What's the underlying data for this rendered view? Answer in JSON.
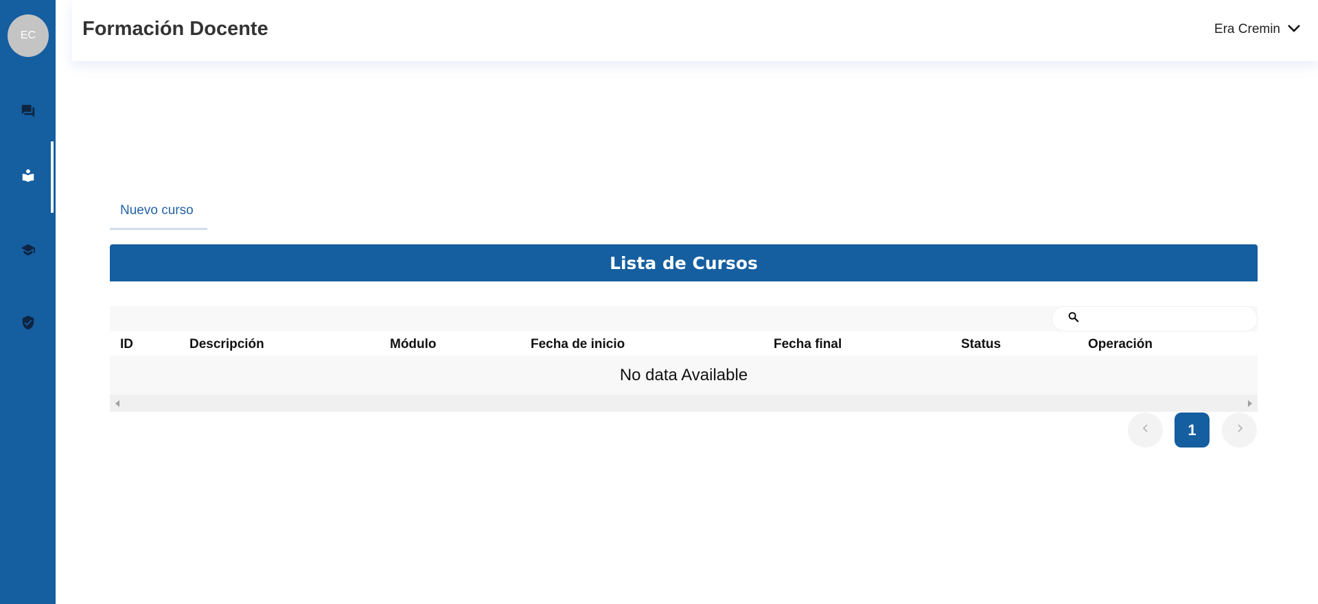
{
  "sidebar": {
    "avatar_initials": "EC",
    "items": [
      {
        "name": "forum",
        "icon": "forum-icon",
        "active": false
      },
      {
        "name": "teaching",
        "icon": "book-reader-icon",
        "active": true
      },
      {
        "name": "education",
        "icon": "graduation-cap-icon",
        "active": false
      },
      {
        "name": "security",
        "icon": "shield-check-icon",
        "active": false
      }
    ]
  },
  "header": {
    "title": "Formación Docente",
    "user_name": "Era Cremin"
  },
  "tabs": [
    {
      "label": "Nuevo curso"
    }
  ],
  "table": {
    "title": "Lista de Cursos",
    "search_placeholder": "",
    "columns": [
      "ID",
      "Descripción",
      "Módulo",
      "Fecha de inicio",
      "Fecha final",
      "Status",
      "Operación"
    ],
    "rows": [],
    "empty_text": "No data Available"
  },
  "pagination": {
    "current_page": "1"
  },
  "colors": {
    "primary": "#155ea0",
    "background": "#ffffff"
  }
}
